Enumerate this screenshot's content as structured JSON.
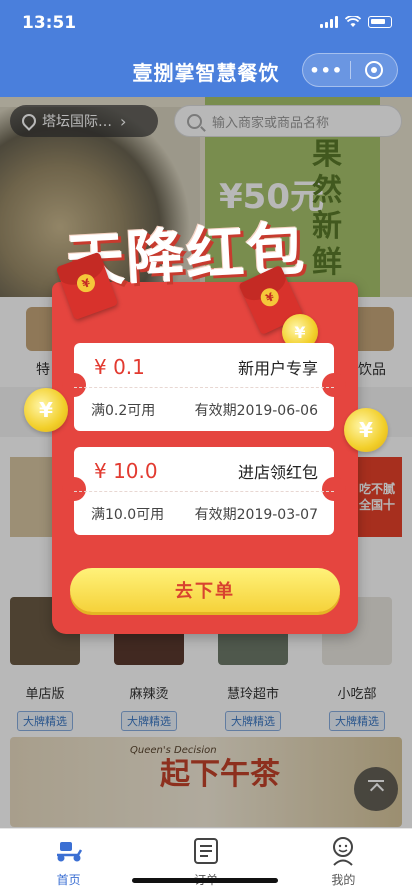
{
  "status_bar": {
    "time": "13:51"
  },
  "header": {
    "title": "壹捌掌智慧餐饮",
    "more_label": "•••"
  },
  "search": {
    "location": "塔坛国际…",
    "placeholder": "输入商家或商品名称"
  },
  "banner": {
    "price_text": "¥50元",
    "fresh_text": "果然新鲜"
  },
  "categories": [
    {
      "label": "特"
    },
    {
      "label": "饮品"
    }
  ],
  "ad_badge": "吃不腻 全国十",
  "stores": [
    {
      "name": "单店版",
      "tag": "大牌精选"
    },
    {
      "name": "麻辣烫",
      "tag": "大牌精选"
    },
    {
      "name": "慧玲超市",
      "tag": "大牌精选"
    },
    {
      "name": "小吃部",
      "tag": "大牌精选"
    }
  ],
  "promo": {
    "script": "Queen's Decision",
    "headline": "起下午茶"
  },
  "popup": {
    "title": "天降红包",
    "coupons": [
      {
        "amount": "¥ 0.1",
        "kind": "新用户专享",
        "condition": "满0.2可用",
        "validity": "有效期2019-06-06"
      },
      {
        "amount": "¥ 10.0",
        "kind": "进店领红包",
        "condition": "满10.0可用",
        "validity": "有效期2019-03-07"
      }
    ],
    "button_label": "去下单",
    "coin_symbol": "¥"
  },
  "tabbar": {
    "items": [
      {
        "label": "首页",
        "icon": "scooter-icon",
        "active": true
      },
      {
        "label": "订单",
        "icon": "list-icon",
        "active": false
      },
      {
        "label": "我的",
        "icon": "person-icon",
        "active": false
      }
    ]
  },
  "colors": {
    "header": "#4a7fdc",
    "popup_red": "#e5453f",
    "button_yellow": "#f5d23a",
    "accent_blue": "#3b6fd3"
  }
}
